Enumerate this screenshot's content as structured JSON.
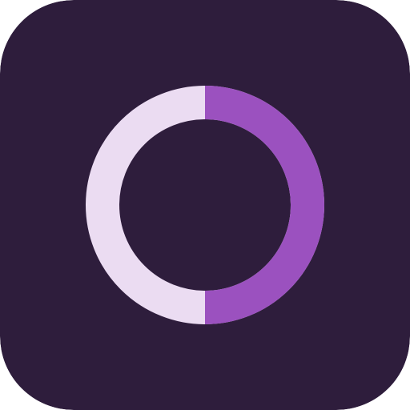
{
  "icon": {
    "name": "ring-progress-icon",
    "colors": {
      "background": "#2E1D3C",
      "ring_track": "#EBDCF2",
      "ring_fill": "#9B51BF"
    },
    "progress_fraction": 0.5
  }
}
